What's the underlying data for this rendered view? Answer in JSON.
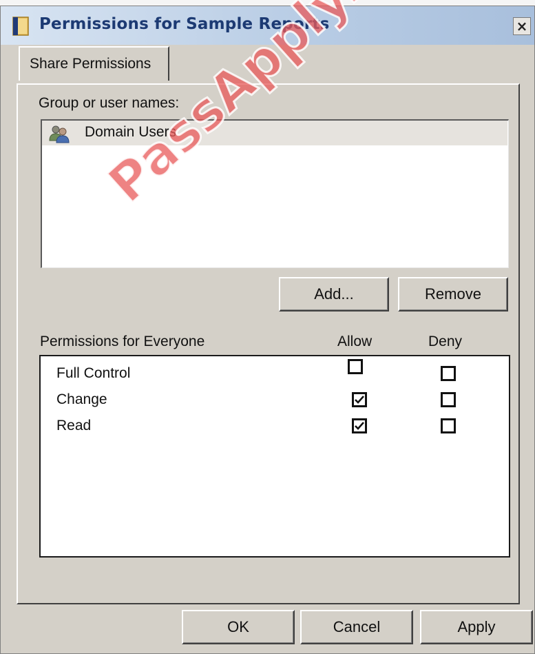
{
  "window": {
    "title": "Permissions for Sample Reports",
    "close_glyph": "×"
  },
  "tabs": [
    {
      "label": "Share Permissions",
      "selected": true
    }
  ],
  "groups": {
    "label": "Group or user names:",
    "items": [
      {
        "name": "Domain Users",
        "icon": "users-icon",
        "selected": true
      }
    ]
  },
  "group_buttons": {
    "add_label": "Add...",
    "remove_label": "Remove"
  },
  "permissions": {
    "label": "Permissions for Everyone",
    "allow_header": "Allow",
    "deny_header": "Deny",
    "rows": [
      {
        "name": "Full Control",
        "allow": false,
        "deny": false
      },
      {
        "name": "Change",
        "allow": true,
        "deny": false
      },
      {
        "name": "Read",
        "allow": true,
        "deny": false
      }
    ]
  },
  "footer": {
    "ok_label": "OK",
    "cancel_label": "Cancel",
    "apply_label": "Apply"
  },
  "watermark": "PassApply.com",
  "colors": {
    "title_text": "#1c3a73",
    "dialog_bg": "#d4d0c8",
    "watermark": "#e85a5a"
  }
}
